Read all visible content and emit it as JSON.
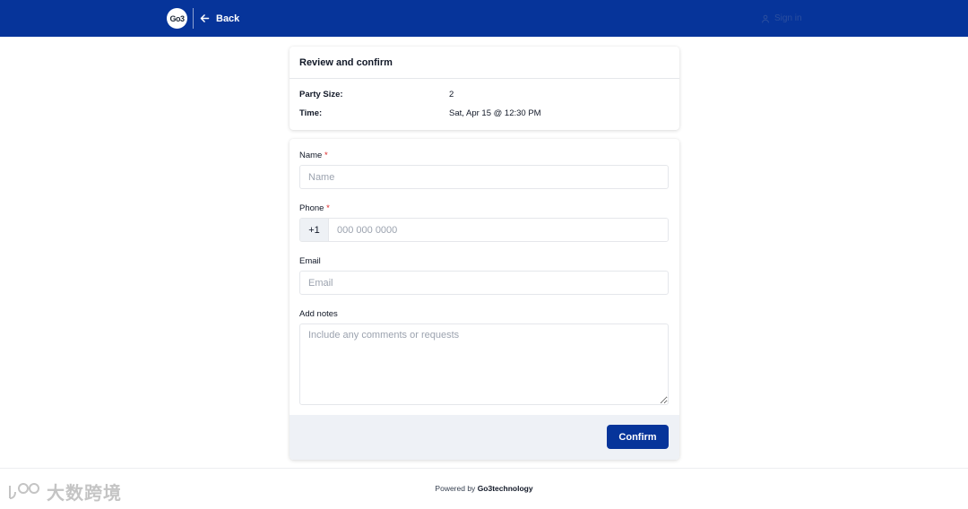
{
  "header": {
    "logo_text": "Go3",
    "back_label": "Back",
    "signin_label": "Sign in",
    "background_color": "#06349a"
  },
  "review": {
    "title": "Review and confirm",
    "rows": [
      {
        "label": "Party Size:",
        "value": "2"
      },
      {
        "label": "Time:",
        "value": "Sat, Apr 15 @ 12:30 PM"
      }
    ]
  },
  "form": {
    "name": {
      "label": "Name",
      "required_mark": "*",
      "placeholder": "Name",
      "value": ""
    },
    "phone": {
      "label": "Phone",
      "required_mark": "*",
      "prefix": "+1",
      "placeholder": "000 000 0000",
      "value": ""
    },
    "email": {
      "label": "Email",
      "placeholder": "Email",
      "value": ""
    },
    "notes": {
      "label": "Add notes",
      "placeholder": "Include any comments or requests",
      "value": ""
    },
    "confirm_label": "Confirm",
    "accent_color": "#06349a"
  },
  "footer": {
    "powered_prefix": "Powered by",
    "powered_brand": "Go3technology"
  },
  "watermark": {
    "text": "大数跨境"
  }
}
